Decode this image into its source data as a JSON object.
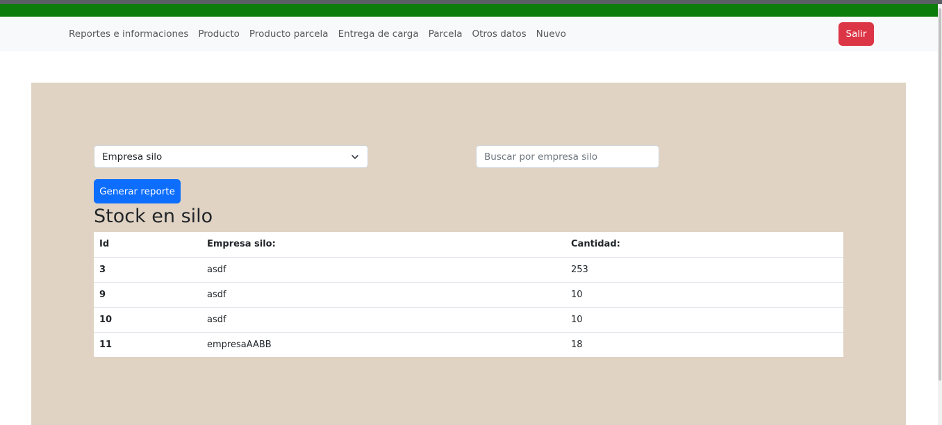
{
  "nav": {
    "items": [
      {
        "label": "Reportes e informaciones"
      },
      {
        "label": "Producto"
      },
      {
        "label": "Producto parcela"
      },
      {
        "label": "Entrega de carga"
      },
      {
        "label": "Parcela"
      },
      {
        "label": "Otros datos"
      },
      {
        "label": "Nuevo"
      }
    ],
    "logout_label": "Salir"
  },
  "filters": {
    "select_value": "Empresa silo",
    "search_placeholder": "Buscar por empresa silo",
    "search_value": "",
    "generate_label": "Generar reporte"
  },
  "report": {
    "title": "Stock en silo",
    "columns": [
      "Id",
      "Empresa silo:",
      "Cantidad:"
    ],
    "rows": [
      [
        "3",
        "asdf",
        "253"
      ],
      [
        "9",
        "asdf",
        "10"
      ],
      [
        "10",
        "asdf",
        "10"
      ],
      [
        "11",
        "empresaAABB",
        "18"
      ]
    ]
  },
  "colors": {
    "green_bar": "#0a7d0a",
    "panel": "#e0d3c3",
    "primary": "#0d6efd",
    "danger": "#dc3545"
  }
}
